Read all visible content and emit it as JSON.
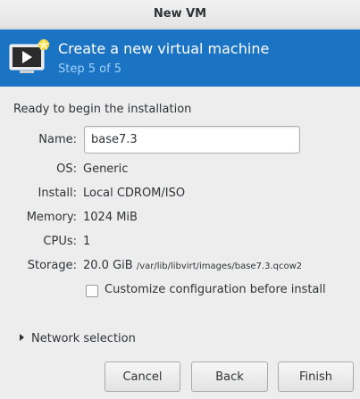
{
  "window": {
    "title": "New VM"
  },
  "header": {
    "title": "Create a new virtual machine",
    "step": "Step 5 of 5",
    "icon": "virtual-machine-icon"
  },
  "summary": {
    "heading": "Ready to begin the installation",
    "name_label": "Name:",
    "name_value": "base7.3",
    "os_label": "OS:",
    "os_value": "Generic",
    "install_label": "Install:",
    "install_value": "Local CDROM/ISO",
    "memory_label": "Memory:",
    "memory_value": "1024 MiB",
    "cpus_label": "CPUs:",
    "cpus_value": "1",
    "storage_label": "Storage:",
    "storage_size": "20.0 GiB",
    "storage_path": "/var/lib/libvirt/images/base7.3.qcow2",
    "customize_label": "Customize configuration before install",
    "customize_checked": false
  },
  "network": {
    "label": "Network selection"
  },
  "buttons": {
    "cancel": "Cancel",
    "back": "Back",
    "finish": "Finish"
  },
  "colors": {
    "header_bg": "#1a73c3",
    "step_text": "#9fd0ff"
  }
}
